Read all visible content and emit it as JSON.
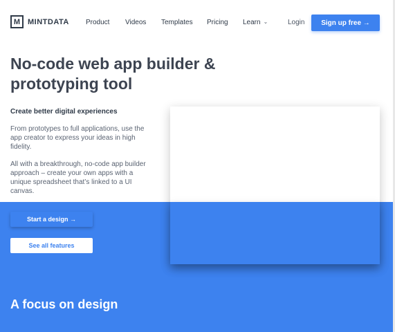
{
  "logo": {
    "mark": "M",
    "name": "MINTDATA"
  },
  "nav": {
    "items": [
      {
        "label": "Product"
      },
      {
        "label": "Videos"
      },
      {
        "label": "Templates"
      },
      {
        "label": "Pricing"
      },
      {
        "label": "Learn"
      }
    ],
    "learn_chevron": "chevron-down-icon",
    "login": "Login",
    "signup": "Sign up free →"
  },
  "hero": {
    "headline": "No-code web app builder & prototyping tool",
    "subhead": "Create better digital experiences",
    "paragraph1": "From prototypes to full applications, use the app creator to express your ideas in high fidelity.",
    "paragraph2": "All with a breakthrough, no-code app builder approach – create your own apps with a unique spreadsheet that’s linked to a UI canvas.",
    "start_button": "Start a design →",
    "features_button": "See all features"
  },
  "section": {
    "title": "A focus on design"
  },
  "colors": {
    "accent": "#3d82ef",
    "text_dark": "#3d4451"
  }
}
